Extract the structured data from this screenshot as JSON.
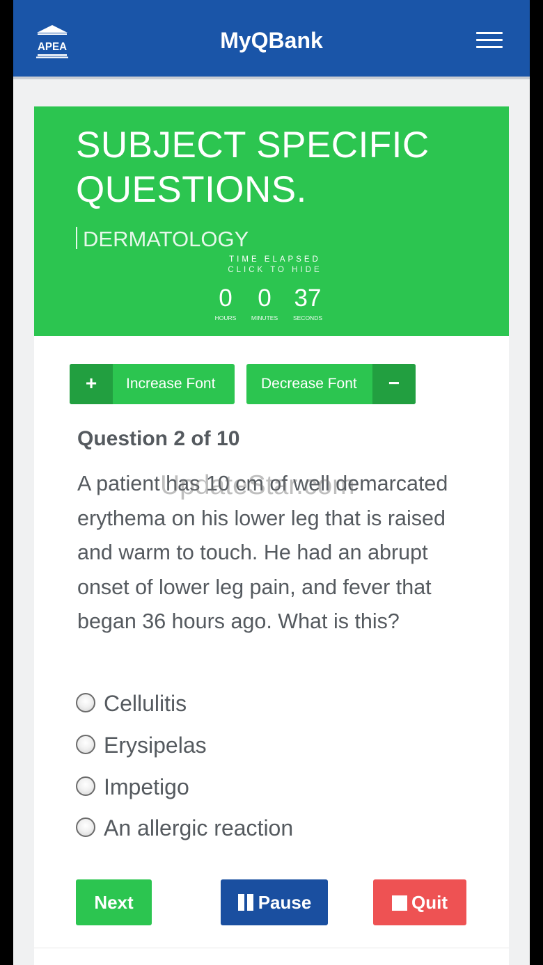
{
  "navbar": {
    "logo_text": "APEA",
    "title": "MyQBank"
  },
  "header": {
    "title": "SUBJECT SPECIFIC QUESTIONS.",
    "subject": "DERMATOLOGY"
  },
  "timer": {
    "heading": "TIME ELAPSED",
    "hide_hint": "CLICK TO HIDE",
    "hours": "0",
    "minutes": "0",
    "seconds": "37",
    "hours_label": "HOURS",
    "minutes_label": "MINUTES",
    "seconds_label": "SECONDS"
  },
  "font_controls": {
    "increase_label": "Increase Font",
    "increase_symbol": "+",
    "decrease_label": "Decrease Font",
    "decrease_symbol": "−"
  },
  "question": {
    "heading": "Question 2 of 10",
    "text": "A patient has 10 cm of well demarcated erythema on his lower leg that is raised and warm to touch. He had an abrupt onset of lower leg pain, and fever that began 36 hours ago. What is this?",
    "options": [
      {
        "label": "Cellulitis"
      },
      {
        "label": "Erysipelas"
      },
      {
        "label": "Impetigo"
      },
      {
        "label": "An allergic reaction"
      }
    ]
  },
  "actions": {
    "next_label": "Next",
    "pause_label": "Pause",
    "quit_label": "Quit"
  },
  "watermark": "UpdateStar.com",
  "colors": {
    "navbar": "#1a55a8",
    "header_green": "#2cc550",
    "font_button_dark": "#229f40",
    "next": "#2cc550",
    "pause": "#1a4fa0",
    "quit": "#ee5253",
    "text": "#555a5f"
  },
  "icons": {
    "logo": "apea-building-logo",
    "menu": "hamburger-menu-icon",
    "pause": "pause-icon",
    "quit": "stop-square-icon"
  }
}
